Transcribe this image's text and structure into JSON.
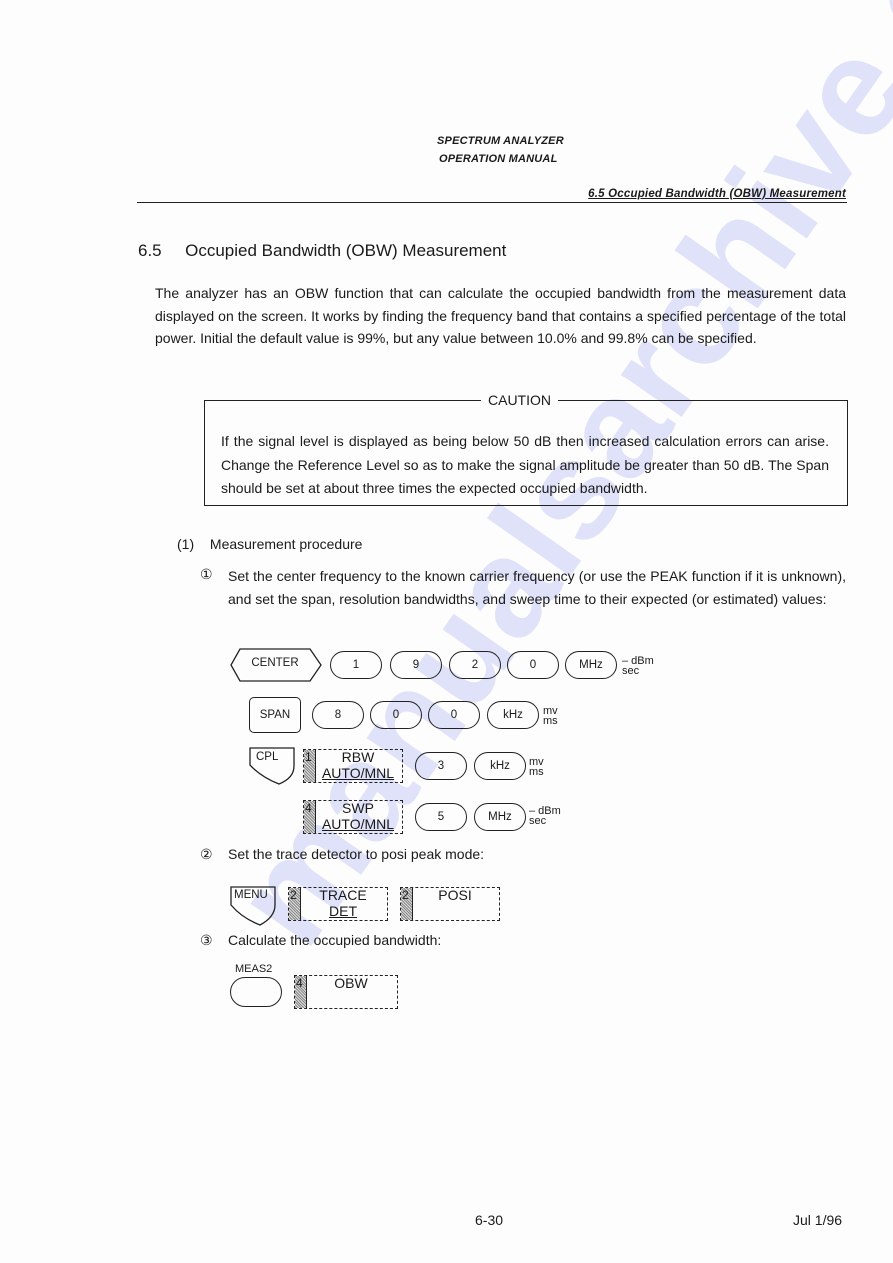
{
  "header": {
    "line1": "SPECTRUM ANALYZER",
    "line2": "OPERATION MANUAL",
    "running_title": "6.5  Occupied Bandwidth (OBW) Measurement"
  },
  "section": {
    "number": "6.5",
    "title": "Occupied Bandwidth (OBW) Measurement",
    "intro": "The analyzer has an OBW function that can calculate the occupied bandwidth from the measurement data displayed on the screen.  It works by finding the frequency band that contains a specified percentage of the total power.  Initial the default value is 99%, but any value between 10.0% and 99.8% can be specified."
  },
  "caution": {
    "label": "CAUTION",
    "text": "If the signal level is displayed as being below 50 dB then increased calculation errors can arise.  Change the Reference Level so as to make the signal amplitude be greater than 50 dB.  The Span should be set at about three times the expected occupied bandwidth."
  },
  "procedure": {
    "heading_num": "(1)",
    "heading": "Measurement procedure",
    "steps": [
      {
        "marker": "①",
        "text": "Set the center frequency to the known carrier frequency (or use the PEAK function if it is unknown), and set the span, resolution bandwidths, and sweep time to their expected (or estimated) values:"
      },
      {
        "marker": "②",
        "text": "Set the trace detector to posi peak mode:"
      },
      {
        "marker": "③",
        "text": "Calculate the occupied bandwidth:"
      }
    ],
    "keys": {
      "center": "CENTER",
      "center_digits": [
        "1",
        "9",
        "2",
        "0"
      ],
      "center_unit": "MHz",
      "center_unit_alt": [
        "– dBm",
        "sec"
      ],
      "span": "SPAN",
      "span_digits": [
        "8",
        "0",
        "0"
      ],
      "span_unit": "kHz",
      "span_unit_alt": [
        "mv",
        "ms"
      ],
      "cpl": "CPL",
      "rbw_soft": {
        "num": "1",
        "line1": "RBW",
        "line2": "AUTO/MNL"
      },
      "rbw_digit": "3",
      "rbw_unit": "kHz",
      "rbw_unit_alt": [
        "mv",
        "ms"
      ],
      "swp_soft": {
        "num": "4",
        "line1": "SWP",
        "line2": "AUTO/MNL"
      },
      "swp_digit": "5",
      "swp_unit": "MHz",
      "swp_unit_alt": [
        "– dBm",
        "sec"
      ],
      "menu": "MENU",
      "trace_soft": {
        "num": "2",
        "line1": "TRACE",
        "line2": "DET"
      },
      "posi_soft": {
        "num": "2",
        "line1": "POSI"
      },
      "meas2": "MEAS2",
      "obw_soft": {
        "num": "4",
        "line1": "OBW"
      }
    }
  },
  "footer": {
    "page": "6-30",
    "date": "Jul 1/96"
  }
}
